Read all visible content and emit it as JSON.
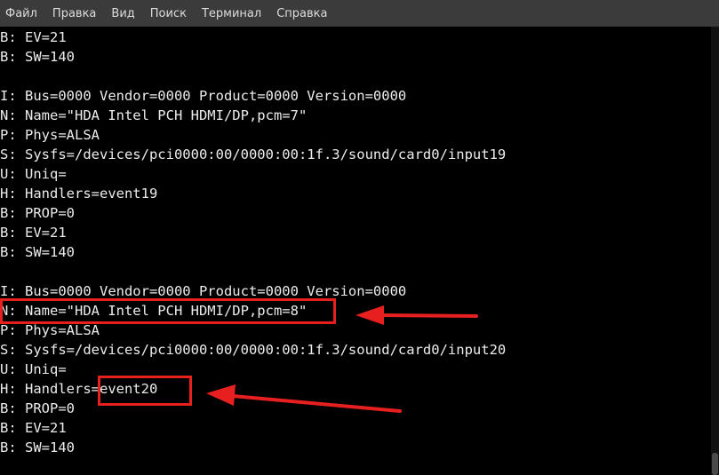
{
  "menu": {
    "items": [
      "Файл",
      "Правка",
      "Вид",
      "Поиск",
      "Терминал",
      "Справка"
    ]
  },
  "terminal": {
    "lines": [
      "B: EV=21",
      "B: SW=140",
      "",
      "I: Bus=0000 Vendor=0000 Product=0000 Version=0000",
      "N: Name=\"HDA Intel PCH HDMI/DP,pcm=7\"",
      "P: Phys=ALSA",
      "S: Sysfs=/devices/pci0000:00/0000:00:1f.3/sound/card0/input19",
      "U: Uniq=",
      "H: Handlers=event19",
      "B: PROP=0",
      "B: EV=21",
      "B: SW=140",
      "",
      "I: Bus=0000 Vendor=0000 Product=0000 Version=0000",
      "N: Name=\"HDA Intel PCH HDMI/DP,pcm=8\"",
      "P: Phys=ALSA",
      "S: Sysfs=/devices/pci0000:00/0000:00:1f.3/sound/card0/input20",
      "U: Uniq=",
      "H: Handlers=event20",
      "B: PROP=0",
      "B: EV=21",
      "B: SW=140"
    ]
  },
  "colors": {
    "menubar_bg": "#3b3b3b",
    "menu_text": "#dcdcdc",
    "terminal_bg": "#000000",
    "terminal_text": "#ececec",
    "annotation": "#e81f1f"
  }
}
